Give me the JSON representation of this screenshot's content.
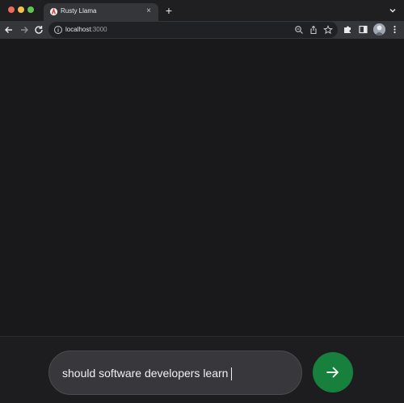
{
  "browser": {
    "tab": {
      "title": "Rusty Llama",
      "close_glyph": "×"
    },
    "new_tab_glyph": "+",
    "address": {
      "host": "localhost",
      "port": ":3000"
    },
    "icons": {
      "back": "arrow-left-icon",
      "forward": "arrow-right-icon",
      "reload": "reload-icon",
      "info": "info-icon",
      "zoom": "zoom-icon",
      "share": "share-icon",
      "bookmark": "star-icon",
      "extensions": "puzzle-icon",
      "sidepanel": "side-panel-icon",
      "menu": "kebab-menu-icon"
    }
  },
  "chat": {
    "input_value": "should software developers learn",
    "send_icon": "arrow-right-icon"
  },
  "colors": {
    "background": "#19191b",
    "input_bg": "#38383c",
    "send_button": "#16803c"
  }
}
